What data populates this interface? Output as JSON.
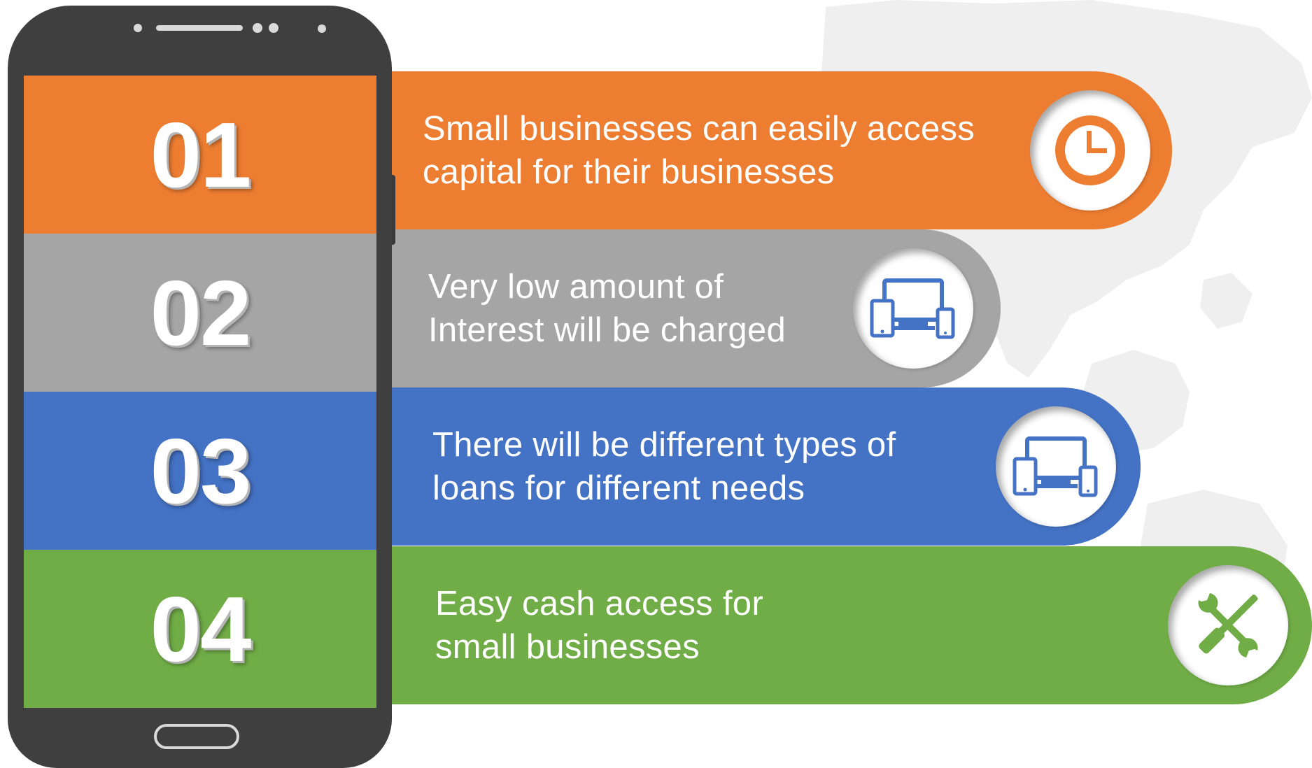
{
  "items": [
    {
      "number": "01",
      "line1": "Small businesses can easily access",
      "line2": "capital for their businesses",
      "color": "#ED7D31",
      "icon": "clock-icon"
    },
    {
      "number": "02",
      "line1": "Very low amount of",
      "line2": "Interest will be charged",
      "color": "#A5A5A5",
      "icon": "devices-icon"
    },
    {
      "number": "03",
      "line1": "There will be different types of",
      "line2": "loans for different needs",
      "color": "#4472C4",
      "icon": "devices-icon"
    },
    {
      "number": "04",
      "line1": "Easy cash access for",
      "line2": "small businesses",
      "color": "#70AD47",
      "icon": "tools-icon"
    }
  ],
  "colors": {
    "phone_body": "#3F3F3F",
    "map": "#EFEFEF"
  }
}
